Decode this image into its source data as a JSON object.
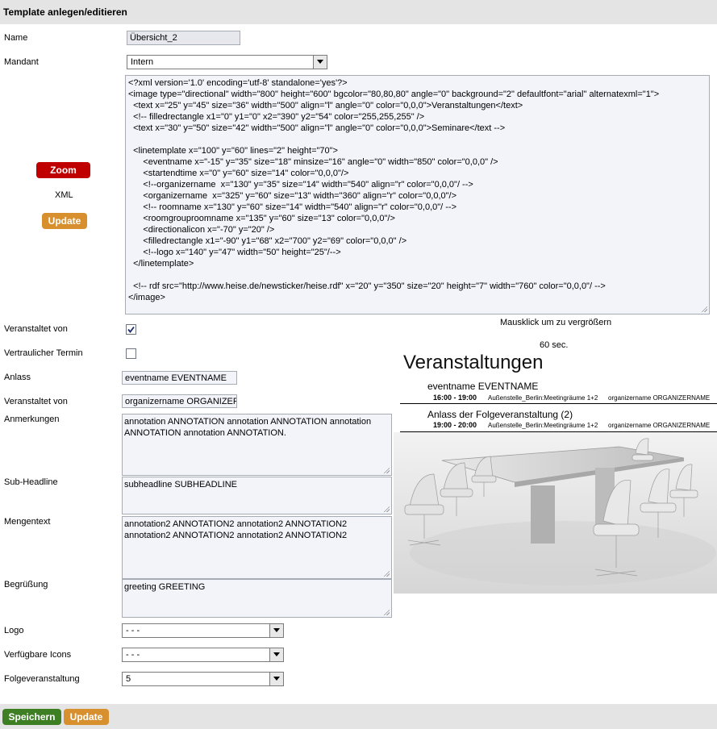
{
  "page": {
    "title": "Template anlegen/editieren"
  },
  "form": {
    "name_label": "Name",
    "name_value": "Übersicht_2",
    "mandant_label": "Mandant",
    "mandant_value": "Intern",
    "veranstaltet_von_cb_label": "Veranstaltet von",
    "veranstaltet_von_checked": true,
    "vertraulich_label": "Vertraulicher Termin",
    "vertraulich_checked": false,
    "anlass_label": "Anlass",
    "anlass_value": "eventname EVENTNAME",
    "veranstaltet_von_label": "Veranstaltet von",
    "veranstaltet_von_value": "organizername ORGANIZERNAME",
    "anmerkungen_label": "Anmerkungen",
    "anmerkungen_value": "annotation ANNOTATION annotation ANNOTATION annotation ANNOTATION annotation ANNOTATION.",
    "subheadline_label": "Sub-Headline",
    "subheadline_value": "subheadline SUBHEADLINE",
    "mengentext_label": "Mengentext",
    "mengentext_value": "annotation2 ANNOTATION2 annotation2 ANNOTATION2 annotation2 ANNOTATION2 annotation2 ANNOTATION2",
    "begruessung_label": "Begrüßung",
    "begruessung_value": "greeting GREETING",
    "logo_label": "Logo",
    "logo_value": "- - -",
    "icons_label": "Verfügbare Icons",
    "icons_value": "- - -",
    "folge_label": "Folgeveranstaltung",
    "folge_value": "5"
  },
  "side": {
    "zoom_label": "Zoom",
    "xml_label": "XML",
    "update_label": "Update"
  },
  "xml": {
    "lines": [
      "<?xml version='1.0' encoding='utf-8' standalone='yes'?>",
      "<image type=\"directional\" width=\"800\" height=\"600\" bgcolor=\"80,80,80\" angle=\"0\" background=\"2\" defaultfont=\"arial\" alternatexml=\"1\">",
      "  <text x=\"25\" y=\"45\" size=\"36\" width=\"500\" align=\"l\" angle=\"0\" color=\"0,0,0\">Veranstaltungen</text>",
      "  <!-- filledrectangle x1=\"0\" y1=\"0\" x2=\"390\" y2=\"54\" color=\"255,255,255\" />",
      "  <text x=\"30\" y=\"50\" size=\"42\" width=\"500\" align=\"l\" angle=\"0\" color=\"0,0,0\">Seminare</text -->",
      "",
      "  <linetemplate x=\"100\" y=\"60\" lines=\"2\" height=\"70\">",
      "      <eventname x=\"-15\" y=\"35\" size=\"18\" minsize=\"16\" angle=\"0\" width=\"850\" color=\"0,0,0\" />",
      "      <startendtime x=\"0\" y=\"60\" size=\"14\" color=\"0,0,0\"/>",
      "      <!--organizername  x=\"130\" y=\"35\" size=\"14\" width=\"540\" align=\"r\" color=\"0,0,0\"/ -->",
      "      <organizername  x=\"325\" y=\"60\" size=\"13\" width=\"360\" align=\"r\" color=\"0,0,0\"/>",
      "      <!-- roomname x=\"130\" y=\"60\" size=\"14\" width=\"540\" align=\"r\" color=\"0,0,0\"/ -->",
      "      <roomgrouproomname x=\"135\" y=\"60\" size=\"13\" color=\"0,0,0\"/>",
      "      <directionalicon x=\"-70\" y=\"20\" />",
      "      <filledrectangle x1=\"-90\" y1=\"68\" x2=\"700\" y2=\"69\" color=\"0,0,0\" />",
      "      <!--logo x=\"140\" y=\"47\" width=\"50\" height=\"25\"/-->",
      "  </linetemplate>",
      "",
      "  <!-- rdf src=\"http://www.heise.de/newsticker/heise.rdf\" x=\"20\" y=\"350\" size=\"20\" height=\"7\" width=\"760\" color=\"0,0,0\"/ -->",
      "</image>"
    ]
  },
  "preview": {
    "hint": "Mausklick um zu vergrößern",
    "refresh": "60 sec.",
    "heading": "Veranstaltungen",
    "events": [
      {
        "name": "eventname EVENTNAME",
        "time": "16:00 - 19:00",
        "room": "Außenstelle_Berlin:Meetingräume 1+2",
        "organizer": "organizername ORGANIZERNAME"
      },
      {
        "name": "Anlass der Folgeveranstaltung (2)",
        "time": "19:00 - 20:00",
        "room": "Außenstelle_Berlin:Meetingräume 1+2",
        "organizer": "organizername ORGANIZERNAME"
      }
    ]
  },
  "footer": {
    "save_label": "Speichern",
    "update_label": "Update"
  },
  "colors": {
    "zoom": "#c00000",
    "update": "#d8902e",
    "save": "#3e7f24"
  }
}
